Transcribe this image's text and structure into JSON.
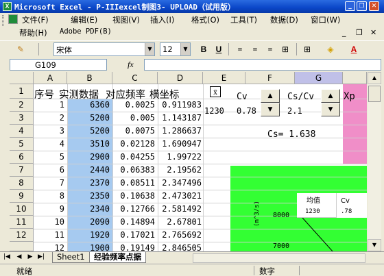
{
  "window": {
    "title": "Microsoft Excel - P-IIIexcel制图3- UPLOAD（试用版）",
    "app_icon_letter": "X"
  },
  "menu": {
    "items": [
      "文件(F)",
      "编辑(E)",
      "视图(V)",
      "插入(I)",
      "格式(O)",
      "工具(T)",
      "数据(D)",
      "窗口(W)"
    ],
    "second_row": [
      "帮助(H)",
      "Adobe PDF(B)"
    ]
  },
  "toolbar": {
    "font_name": "宋体",
    "font_size": "12",
    "bold": "B",
    "underline": "U"
  },
  "formula_bar": {
    "name_box": "G109",
    "fx": "fx",
    "formula": ""
  },
  "columns": [
    "A",
    "B",
    "C",
    "D",
    "E",
    "F",
    "G"
  ],
  "rows": [
    "1",
    "2",
    "3",
    "4",
    "5",
    "6",
    "7",
    "8",
    "9",
    "10",
    "11",
    "12"
  ],
  "header_row": {
    "seq": "序号",
    "measured": "实测数据",
    "freq": "对应频率",
    "axis": "横坐标"
  },
  "params": {
    "xbar_symbol": "x̄",
    "xbar_value": "1230",
    "cv_label": "Cv",
    "cv_value": "0.78",
    "cscv_label": "Cs/Cv",
    "cscv_value": "2.1",
    "cs_text": "Cs= 1.638",
    "xp_label": "Xp"
  },
  "table": [
    {
      "n": "1",
      "b": "6360",
      "c": "0.0025",
      "d": "0.911983"
    },
    {
      "n": "2",
      "b": "5200",
      "c": "0.005",
      "d": "1.143187"
    },
    {
      "n": "3",
      "b": "5200",
      "c": "0.0075",
      "d": "1.286637"
    },
    {
      "n": "4",
      "b": "3510",
      "c": "0.02128",
      "d": "1.690947"
    },
    {
      "n": "5",
      "b": "2900",
      "c": "0.04255",
      "d": "1.99722"
    },
    {
      "n": "6",
      "b": "2440",
      "c": "0.06383",
      "d": "2.19562"
    },
    {
      "n": "7",
      "b": "2370",
      "c": "0.08511",
      "d": "2.347496"
    },
    {
      "n": "8",
      "b": "2350",
      "c": "0.10638",
      "d": "2.473021"
    },
    {
      "n": "9",
      "b": "2340",
      "c": "0.12766",
      "d": "2.581492"
    },
    {
      "n": "10",
      "b": "2090",
      "c": "0.14894",
      "d": "2.67801"
    },
    {
      "n": "11",
      "b": "1920",
      "c": "0.17021",
      "d": "2.765692"
    },
    {
      "n": "12",
      "b": "1900",
      "c": "0.19149",
      "d": "2.846505"
    }
  ],
  "chart": {
    "legend": [
      "均值",
      "Cv"
    ],
    "legend_values": [
      "1230",
      ".78"
    ],
    "y_ticks": [
      "8000",
      "7000"
    ],
    "y_label": "(m^3/s)"
  },
  "tabs": [
    "Sheet1",
    "经验频率点据"
  ],
  "status": {
    "left": "就绪",
    "num": "数字"
  },
  "colors": {
    "blue_fill": "#a6caf0",
    "green_chart": "#33ff33",
    "pink": "#f08ec8",
    "title_blue": "#0a46c8"
  }
}
